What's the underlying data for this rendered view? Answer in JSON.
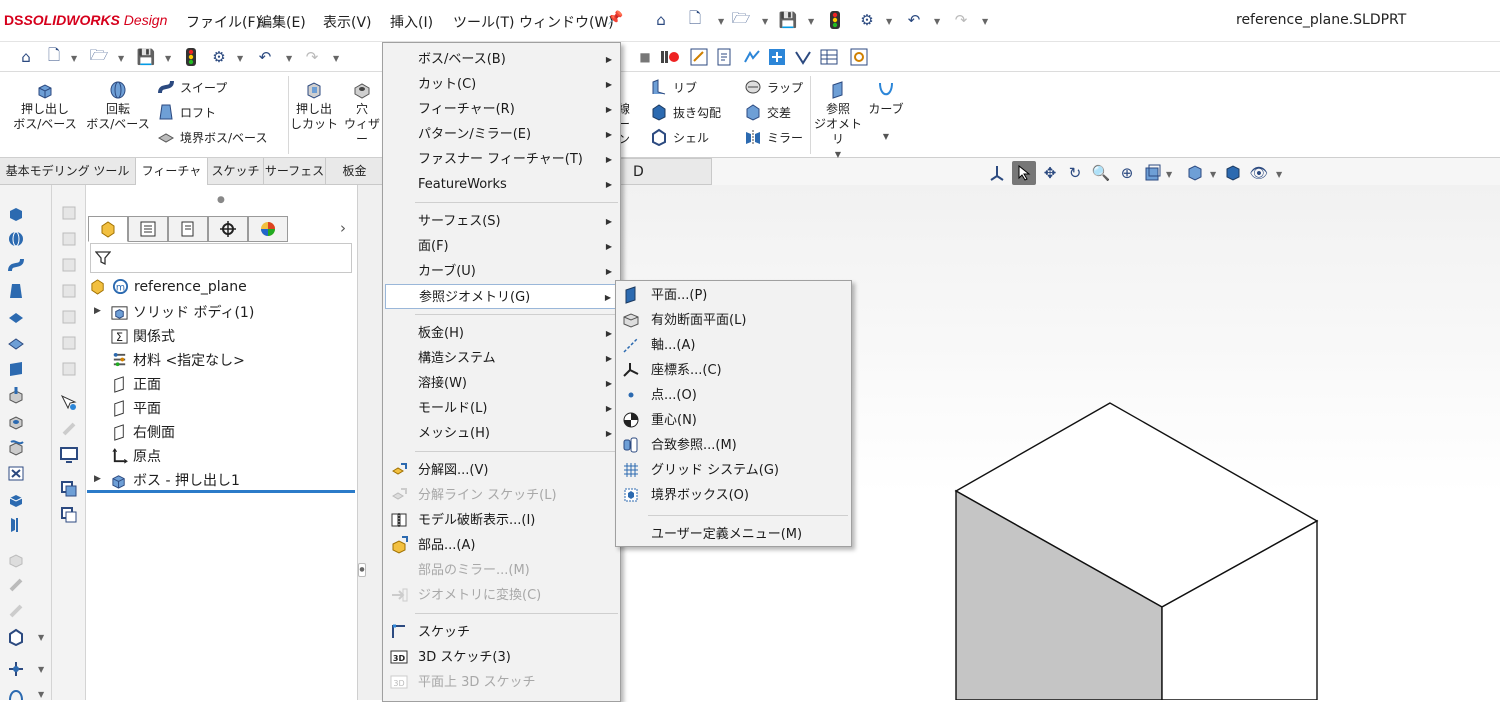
{
  "app": {
    "logo_prefix": "DS",
    "logo_brand": "SOLIDWORKS",
    "logo_suffix": " Design",
    "file_title": "reference_plane.SLDPRT"
  },
  "main_menu": [
    "ファイル(F)",
    "編集(E)",
    "表示(V)",
    "挿入(I)",
    "ツール(T)",
    "ウィンドウ(W)"
  ],
  "command_manager": {
    "extrude_boss": [
      "押し出し",
      "ボス/ベース"
    ],
    "revolve_boss": [
      "回転",
      "ボス/ベース"
    ],
    "sweep": "スイープ",
    "loft": "ロフト",
    "boundary_boss": "境界ボス/ベース",
    "extrude_cut": [
      "押し出",
      "しカット"
    ],
    "hole_wizard": [
      "穴",
      "ウィザー"
    ],
    "line_partial": [
      "線",
      "ーン"
    ],
    "rib": "リブ",
    "draft": "抜き勾配",
    "shell": "シェル",
    "wrap": "ラップ",
    "intersect": "交差",
    "mirror": "ミラー",
    "ref_geometry": [
      "参照",
      "ジオメトリ"
    ],
    "curves": "カーブ"
  },
  "tabs": [
    "基本モデリング ツール",
    "フィーチャー",
    "スケッチ",
    "サーフェス",
    "板金"
  ],
  "dim_tab": "D Dimension",
  "feature_tree": {
    "root": "reference_plane",
    "items": [
      "ソリッド ボディ(1)",
      "関係式",
      "材料 <指定なし>",
      "正面",
      "平面",
      "右側面",
      "原点",
      "ボス - 押し出し1"
    ]
  },
  "insert_menu": {
    "groups": [
      [
        {
          "label": "ボス/ベース(B)",
          "submenu": true,
          "disabled": false
        },
        {
          "label": "カット(C)",
          "submenu": true,
          "disabled": false
        },
        {
          "label": "フィーチャー(R)",
          "submenu": true,
          "disabled": false
        },
        {
          "label": "パターン/ミラー(E)",
          "submenu": true,
          "disabled": false
        },
        {
          "label": "ファスナー フィーチャー(T)",
          "submenu": true,
          "disabled": false
        },
        {
          "label": "FeatureWorks",
          "submenu": true,
          "disabled": false
        }
      ],
      [
        {
          "label": "サーフェス(S)",
          "submenu": true,
          "disabled": false
        },
        {
          "label": "面(F)",
          "submenu": true,
          "disabled": false
        },
        {
          "label": "カーブ(U)",
          "submenu": true,
          "disabled": false
        },
        {
          "label": "参照ジオメトリ(G)",
          "submenu": true,
          "disabled": false
        }
      ],
      [
        {
          "label": "板金(H)",
          "submenu": true,
          "disabled": false
        },
        {
          "label": "構造システム",
          "submenu": true,
          "disabled": false
        },
        {
          "label": "溶接(W)",
          "submenu": true,
          "disabled": false
        },
        {
          "label": "モールド(L)",
          "submenu": true,
          "disabled": false
        },
        {
          "label": "メッシュ(H)",
          "submenu": true,
          "disabled": false
        }
      ],
      [
        {
          "label": "分解図...(V)",
          "submenu": false,
          "disabled": false
        },
        {
          "label": "分解ライン スケッチ(L)",
          "submenu": false,
          "disabled": true
        },
        {
          "label": "モデル破断表示...(I)",
          "submenu": false,
          "disabled": false
        },
        {
          "label": "部品...(A)",
          "submenu": false,
          "disabled": false
        },
        {
          "label": "部品のミラー...(M)",
          "submenu": false,
          "disabled": true
        },
        {
          "label": "ジオメトリに変換(C)",
          "submenu": false,
          "disabled": true
        }
      ],
      [
        {
          "label": "スケッチ",
          "submenu": false,
          "disabled": false
        },
        {
          "label": "3D スケッチ(3)",
          "submenu": false,
          "disabled": false
        },
        {
          "label": "平面上 3D スケッチ",
          "submenu": false,
          "disabled": true
        }
      ]
    ]
  },
  "ref_geometry_menu": {
    "items": [
      "平面...(P)",
      "有効断面平面(L)",
      "軸...(A)",
      "座標系...(C)",
      "点...(O)",
      "重心(N)",
      "合致参照...(M)",
      "グリッド システム(G)",
      "境界ボックス(O)"
    ],
    "custom": "ユーザー定義メニュー(M)"
  },
  "colors": {
    "accent_blue": "#2b7bc9",
    "brand_red": "#d6001c",
    "menu_bg": "#f2f2f2",
    "disabled": "#a8a8a8"
  }
}
